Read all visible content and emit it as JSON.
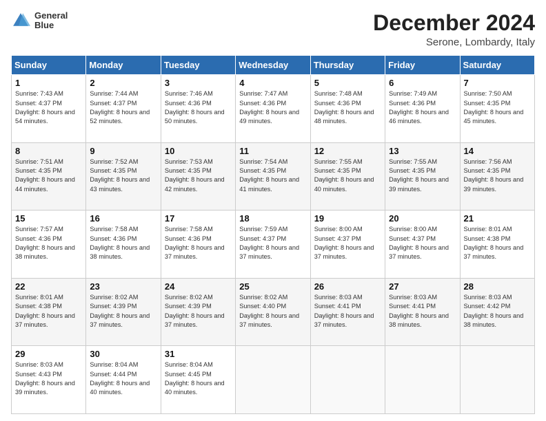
{
  "header": {
    "logo_line1": "General",
    "logo_line2": "Blue",
    "title": "December 2024",
    "subtitle": "Serone, Lombardy, Italy"
  },
  "days_of_week": [
    "Sunday",
    "Monday",
    "Tuesday",
    "Wednesday",
    "Thursday",
    "Friday",
    "Saturday"
  ],
  "weeks": [
    [
      {
        "day": "1",
        "sunrise": "7:43 AM",
        "sunset": "4:37 PM",
        "daylight": "8 hours and 54 minutes."
      },
      {
        "day": "2",
        "sunrise": "7:44 AM",
        "sunset": "4:37 PM",
        "daylight": "8 hours and 52 minutes."
      },
      {
        "day": "3",
        "sunrise": "7:46 AM",
        "sunset": "4:36 PM",
        "daylight": "8 hours and 50 minutes."
      },
      {
        "day": "4",
        "sunrise": "7:47 AM",
        "sunset": "4:36 PM",
        "daylight": "8 hours and 49 minutes."
      },
      {
        "day": "5",
        "sunrise": "7:48 AM",
        "sunset": "4:36 PM",
        "daylight": "8 hours and 48 minutes."
      },
      {
        "day": "6",
        "sunrise": "7:49 AM",
        "sunset": "4:36 PM",
        "daylight": "8 hours and 46 minutes."
      },
      {
        "day": "7",
        "sunrise": "7:50 AM",
        "sunset": "4:35 PM",
        "daylight": "8 hours and 45 minutes."
      }
    ],
    [
      {
        "day": "8",
        "sunrise": "7:51 AM",
        "sunset": "4:35 PM",
        "daylight": "8 hours and 44 minutes."
      },
      {
        "day": "9",
        "sunrise": "7:52 AM",
        "sunset": "4:35 PM",
        "daylight": "8 hours and 43 minutes."
      },
      {
        "day": "10",
        "sunrise": "7:53 AM",
        "sunset": "4:35 PM",
        "daylight": "8 hours and 42 minutes."
      },
      {
        "day": "11",
        "sunrise": "7:54 AM",
        "sunset": "4:35 PM",
        "daylight": "8 hours and 41 minutes."
      },
      {
        "day": "12",
        "sunrise": "7:55 AM",
        "sunset": "4:35 PM",
        "daylight": "8 hours and 40 minutes."
      },
      {
        "day": "13",
        "sunrise": "7:55 AM",
        "sunset": "4:35 PM",
        "daylight": "8 hours and 39 minutes."
      },
      {
        "day": "14",
        "sunrise": "7:56 AM",
        "sunset": "4:35 PM",
        "daylight": "8 hours and 39 minutes."
      }
    ],
    [
      {
        "day": "15",
        "sunrise": "7:57 AM",
        "sunset": "4:36 PM",
        "daylight": "8 hours and 38 minutes."
      },
      {
        "day": "16",
        "sunrise": "7:58 AM",
        "sunset": "4:36 PM",
        "daylight": "8 hours and 38 minutes."
      },
      {
        "day": "17",
        "sunrise": "7:58 AM",
        "sunset": "4:36 PM",
        "daylight": "8 hours and 37 minutes."
      },
      {
        "day": "18",
        "sunrise": "7:59 AM",
        "sunset": "4:37 PM",
        "daylight": "8 hours and 37 minutes."
      },
      {
        "day": "19",
        "sunrise": "8:00 AM",
        "sunset": "4:37 PM",
        "daylight": "8 hours and 37 minutes."
      },
      {
        "day": "20",
        "sunrise": "8:00 AM",
        "sunset": "4:37 PM",
        "daylight": "8 hours and 37 minutes."
      },
      {
        "day": "21",
        "sunrise": "8:01 AM",
        "sunset": "4:38 PM",
        "daylight": "8 hours and 37 minutes."
      }
    ],
    [
      {
        "day": "22",
        "sunrise": "8:01 AM",
        "sunset": "4:38 PM",
        "daylight": "8 hours and 37 minutes."
      },
      {
        "day": "23",
        "sunrise": "8:02 AM",
        "sunset": "4:39 PM",
        "daylight": "8 hours and 37 minutes."
      },
      {
        "day": "24",
        "sunrise": "8:02 AM",
        "sunset": "4:39 PM",
        "daylight": "8 hours and 37 minutes."
      },
      {
        "day": "25",
        "sunrise": "8:02 AM",
        "sunset": "4:40 PM",
        "daylight": "8 hours and 37 minutes."
      },
      {
        "day": "26",
        "sunrise": "8:03 AM",
        "sunset": "4:41 PM",
        "daylight": "8 hours and 37 minutes."
      },
      {
        "day": "27",
        "sunrise": "8:03 AM",
        "sunset": "4:41 PM",
        "daylight": "8 hours and 38 minutes."
      },
      {
        "day": "28",
        "sunrise": "8:03 AM",
        "sunset": "4:42 PM",
        "daylight": "8 hours and 38 minutes."
      }
    ],
    [
      {
        "day": "29",
        "sunrise": "8:03 AM",
        "sunset": "4:43 PM",
        "daylight": "8 hours and 39 minutes."
      },
      {
        "day": "30",
        "sunrise": "8:04 AM",
        "sunset": "4:44 PM",
        "daylight": "8 hours and 40 minutes."
      },
      {
        "day": "31",
        "sunrise": "8:04 AM",
        "sunset": "4:45 PM",
        "daylight": "8 hours and 40 minutes."
      },
      null,
      null,
      null,
      null
    ]
  ]
}
